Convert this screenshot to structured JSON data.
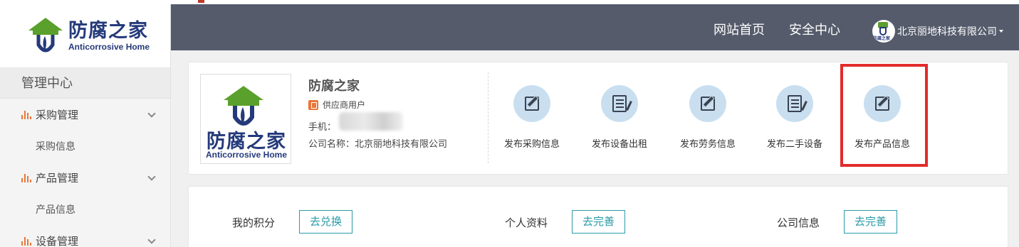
{
  "sidebar": {
    "logo_cn": "防腐之家",
    "logo_en": "Anticorrosive Home",
    "title": "管理中心",
    "groups": [
      {
        "label": "采购管理",
        "sub": "采购信息"
      },
      {
        "label": "产品管理",
        "sub": "产品信息"
      },
      {
        "label": "设备管理"
      }
    ]
  },
  "header": {
    "nav_home": "网站首页",
    "nav_security": "安全中心",
    "avatar_text": "防腐之家",
    "user_name": "北京丽地科技有限公司"
  },
  "profile": {
    "logo_cn": "防腐之家",
    "logo_en": "Anticorrosive Home",
    "company_name": "防腐之家",
    "user_type": "供应商用户",
    "phone_label": "手机：",
    "company_full": "公司名称：北京丽地科技有限公司"
  },
  "actions": [
    {
      "label": "发布采购信息",
      "icon": "edit-icon"
    },
    {
      "label": "发布设备出租",
      "icon": "document-icon"
    },
    {
      "label": "发布劳务信息",
      "icon": "edit-icon"
    },
    {
      "label": "发布二手设备",
      "icon": "document-icon"
    },
    {
      "label": "发布产品信息",
      "icon": "edit-icon"
    }
  ],
  "points": {
    "my_points_label": "我的积分",
    "my_points_btn": "去兑换",
    "personal_label": "个人资料",
    "personal_btn": "去完善",
    "company_label": "公司信息",
    "company_btn": "去完善"
  },
  "colors": {
    "header_bg": "#555b6b",
    "accent_teal": "#2a9ba8",
    "highlight_red": "#e22b2b",
    "icon_circle": "#c9dff0",
    "menu_icon_orange": "#e8773a"
  }
}
